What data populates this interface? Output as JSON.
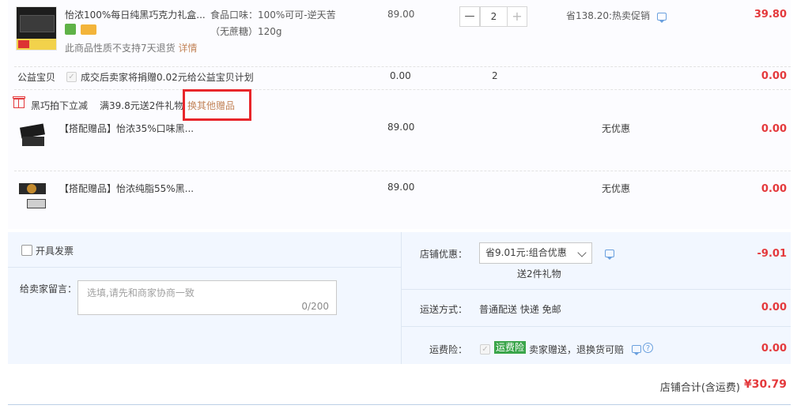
{
  "product": {
    "title": "怡浓100%每日纯黑巧克力礼盒...",
    "option_label": "食品口味：100%可可-逆天苦",
    "option_detail": "（无蔗糖）120g",
    "notice": "此商品性质不支持7天退货",
    "detail_link": "详情",
    "price": "89.00",
    "quantity": "2",
    "minus": "—",
    "plus": "+",
    "promo": "省138.20:热卖促销",
    "total": "39.80"
  },
  "charity": {
    "label": "公益宝贝",
    "text": "成交后卖家将捐赠0.02元给公益宝贝计划",
    "price": "0.00",
    "quantity": "2",
    "total": "0.00"
  },
  "gift_bar": {
    "title": "黑巧拍下立减",
    "rule": "满39.8元送2件礼物",
    "change_link": "换其他赠品"
  },
  "gifts": [
    {
      "title": "【搭配赠品】怡浓35%口味黑...",
      "price": "89.00",
      "promo": "无优惠",
      "total": "0.00"
    },
    {
      "title": "【搭配赠品】怡浓纯脂55%黑...",
      "price": "89.00",
      "promo": "无优惠",
      "total": "0.00"
    }
  ],
  "order": {
    "invoice_label": "开具发票",
    "message_label": "给卖家留言：",
    "message_placeholder": "选填,请先和商家协商一致",
    "message_count": "0/200",
    "shop_discount_label": "店铺优惠：",
    "shop_discount_value": "省9.01元:组合优惠",
    "shop_discount_sub": "送2件礼物",
    "shop_discount_amount": "-9.01",
    "shipping_label": "运送方式：",
    "shipping_value": "普通配送 快递 免邮",
    "shipping_amount": "0.00",
    "insurance_label": "运费险：",
    "insurance_badge": "运费险",
    "insurance_text": "卖家赠送，退换货可赔",
    "insurance_amount": "0.00"
  },
  "footer": {
    "total_label": "店铺合计(含运费)",
    "total_value": "¥30.79"
  },
  "colors": {
    "price_red": "#e4393c",
    "link_orange": "#c3855a",
    "highlight_red": "#e8262b",
    "badge_green": "#3aa54a"
  }
}
